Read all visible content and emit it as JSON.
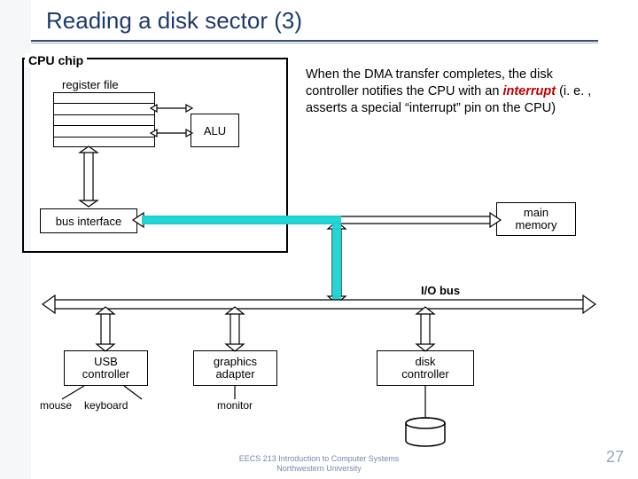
{
  "title": "Reading a disk sector (3)",
  "cpu": {
    "chip_label": "CPU chip",
    "regfile_label": "register file",
    "alu_label": "ALU",
    "bus_interface_label": "bus interface"
  },
  "description": {
    "pre": "When the DMA transfer completes, the disk controller notifies the CPU with an ",
    "emph": "interrupt",
    "post": " (i. e. , asserts a special “interrupt” pin on the CPU)"
  },
  "mainmem": {
    "label1": "main",
    "label2": "memory"
  },
  "iobus_label": "I/O bus",
  "controllers": {
    "usb": {
      "label1": "USB",
      "label2": "controller"
    },
    "gfx": {
      "label1": "graphics",
      "label2": "adapter"
    },
    "disk": {
      "label1": "disk",
      "label2": "controller"
    }
  },
  "devices": {
    "mouse": "mouse",
    "keyboard": "keyboard",
    "monitor": "monitor",
    "disk": "disk"
  },
  "footer": {
    "line1": "EECS 213 Introduction to Computer Systems",
    "line2": "Northwestern University"
  },
  "pagenum": "27",
  "colors": {
    "highlight": "#18d4d4"
  }
}
